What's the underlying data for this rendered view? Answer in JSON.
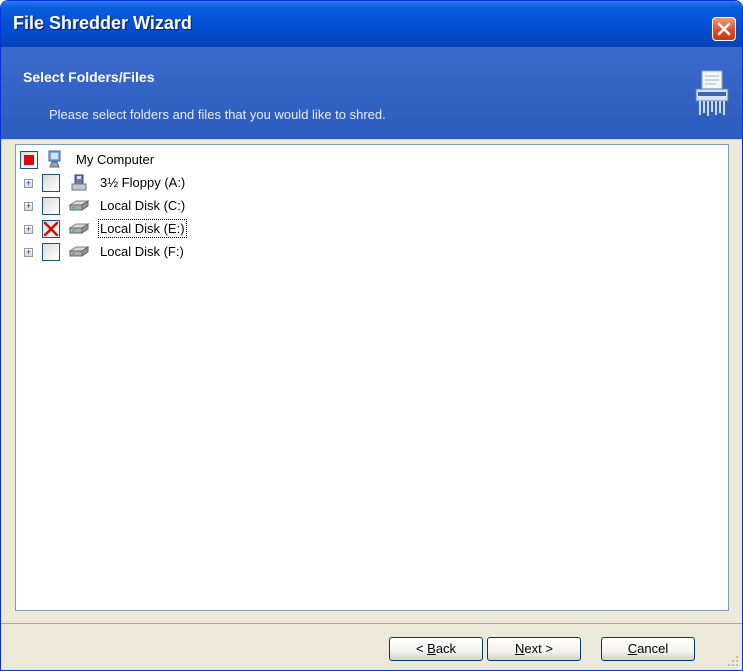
{
  "window": {
    "title": "File Shredder Wizard",
    "close_icon": "close-icon"
  },
  "header": {
    "title": "Select Folders/Files",
    "subtitle": "Please select folders and files that you would like to shred.",
    "icon": "shredder-icon"
  },
  "tree": {
    "root": {
      "label": "My Computer",
      "state": "partial",
      "icon": "computer-icon"
    },
    "items": [
      {
        "label": "3½ Floppy (A:)",
        "state": "unchecked",
        "icon": "floppy-drive-icon"
      },
      {
        "label": "Local Disk (C:)",
        "state": "unchecked",
        "icon": "hard-disk-icon"
      },
      {
        "label": "Local Disk (E:)",
        "state": "checked",
        "icon": "hard-disk-icon",
        "focused": true
      },
      {
        "label": "Local Disk (F:)",
        "state": "unchecked",
        "icon": "hard-disk-icon"
      }
    ]
  },
  "buttons": {
    "back": {
      "prefix": "< ",
      "accel": "B",
      "rest": "ack"
    },
    "next": {
      "accel": "N",
      "rest": "ext >"
    },
    "cancel": {
      "accel": "C",
      "rest": "ancel"
    }
  },
  "colors": {
    "title_bar": "#0553d8",
    "header": "#3a6acb",
    "accent_red": "#d40c0c"
  }
}
